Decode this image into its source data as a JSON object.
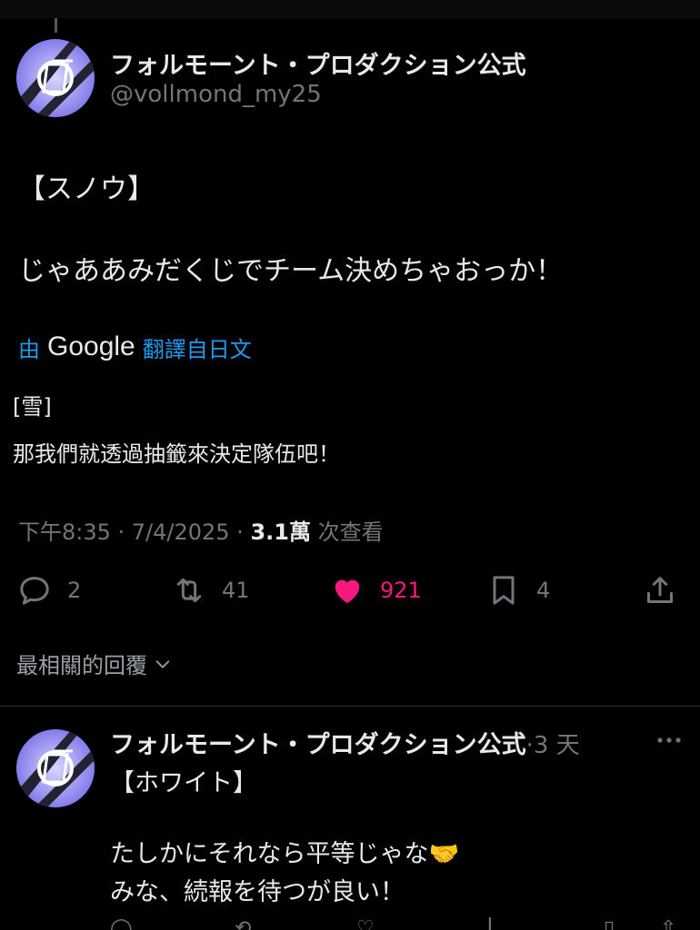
{
  "tweet": {
    "author_name": "フォルモーント・プロダクション公式",
    "handle": "@vollmond_my25",
    "speaker": "【スノウ】",
    "body": "じゃああみだくじでチーム決めちゃおっか！",
    "translate": {
      "prefix": "由",
      "brand": "Google",
      "suffix": "翻譯自日文"
    },
    "translated_speaker": "[雪]",
    "translated_body": "那我們就透過抽籤來決定隊伍吧！",
    "time": "下午8:35 · 7/4/2025 · ",
    "views_count": "3.1萬",
    "views_label": " 次查看"
  },
  "actions": {
    "replies": "2",
    "retweets": "41",
    "likes": "921",
    "bookmarks": "4"
  },
  "sort_label": "最相關的回覆",
  "reply": {
    "author_name": "フォルモーント・プロダクション公式",
    "time": "·3 天",
    "speaker": "【ホワイト】",
    "line1": "たしかにそれなら平等じゃな🤝",
    "line2": "みな、続報を待つが良い！"
  },
  "colors": {
    "accent": "#1d9bf0",
    "like": "#f91880",
    "muted": "#71767b"
  },
  "icons": [
    "reply-icon",
    "retweet-icon",
    "heart-icon",
    "bookmark-icon",
    "share-icon",
    "chevron-down-icon",
    "more-icon"
  ]
}
